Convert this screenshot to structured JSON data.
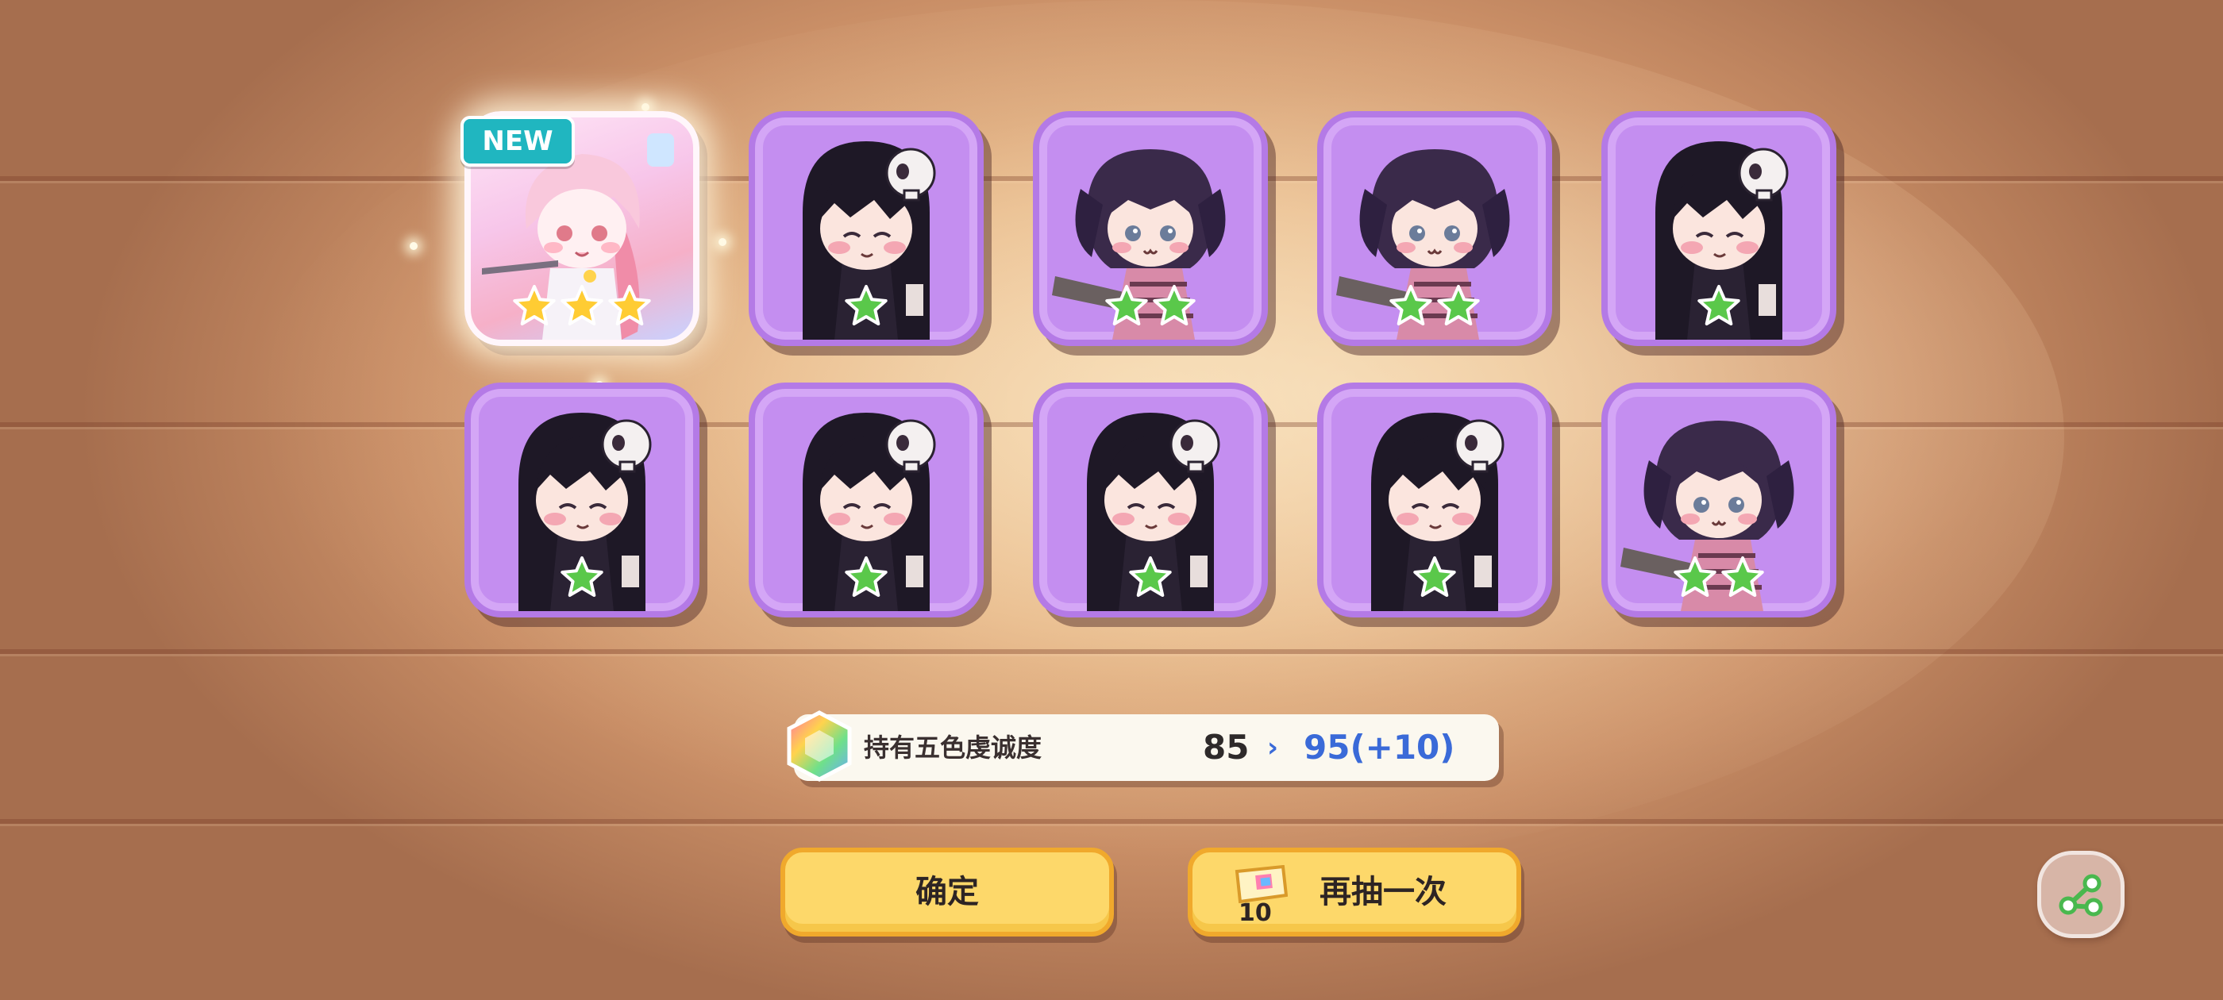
{
  "badge": {
    "new": "NEW"
  },
  "cards": [
    {
      "character": "pink-haired-girl",
      "rarity": 3,
      "featured": true,
      "is_new": true
    },
    {
      "character": "black-hair-skull-girl",
      "rarity": 1
    },
    {
      "character": "dark-purple-dog-ear-girl",
      "rarity": 2
    },
    {
      "character": "dark-purple-dog-ear-girl",
      "rarity": 2
    },
    {
      "character": "black-hair-skull-girl",
      "rarity": 1
    },
    {
      "character": "black-hair-skull-girl",
      "rarity": 1
    },
    {
      "character": "black-hair-skull-girl",
      "rarity": 1
    },
    {
      "character": "black-hair-skull-girl",
      "rarity": 1
    },
    {
      "character": "black-hair-skull-girl",
      "rarity": 1
    },
    {
      "character": "dark-purple-dog-ear-girl",
      "rarity": 2
    }
  ],
  "devotion": {
    "label": "持有五色虔诚度",
    "current": "85",
    "arrow": "›",
    "next": "95(+10)"
  },
  "buttons": {
    "confirm": "确定",
    "redraw": "再抽一次",
    "ticket_count": "10"
  },
  "colors": {
    "card_bg": "#c48ef0",
    "star_gold": "#ffcc33",
    "star_green": "#5ac84a",
    "button_yellow": "#fdd86a",
    "accent_blue": "#3a6ad8",
    "badge_teal": "#20b6c0"
  },
  "icons": {
    "star3": "gold-star-icon",
    "star1": "green-star-icon",
    "devotion": "rainbow-gem-icon",
    "ticket": "draw-ticket-icon",
    "share": "share-icon"
  }
}
